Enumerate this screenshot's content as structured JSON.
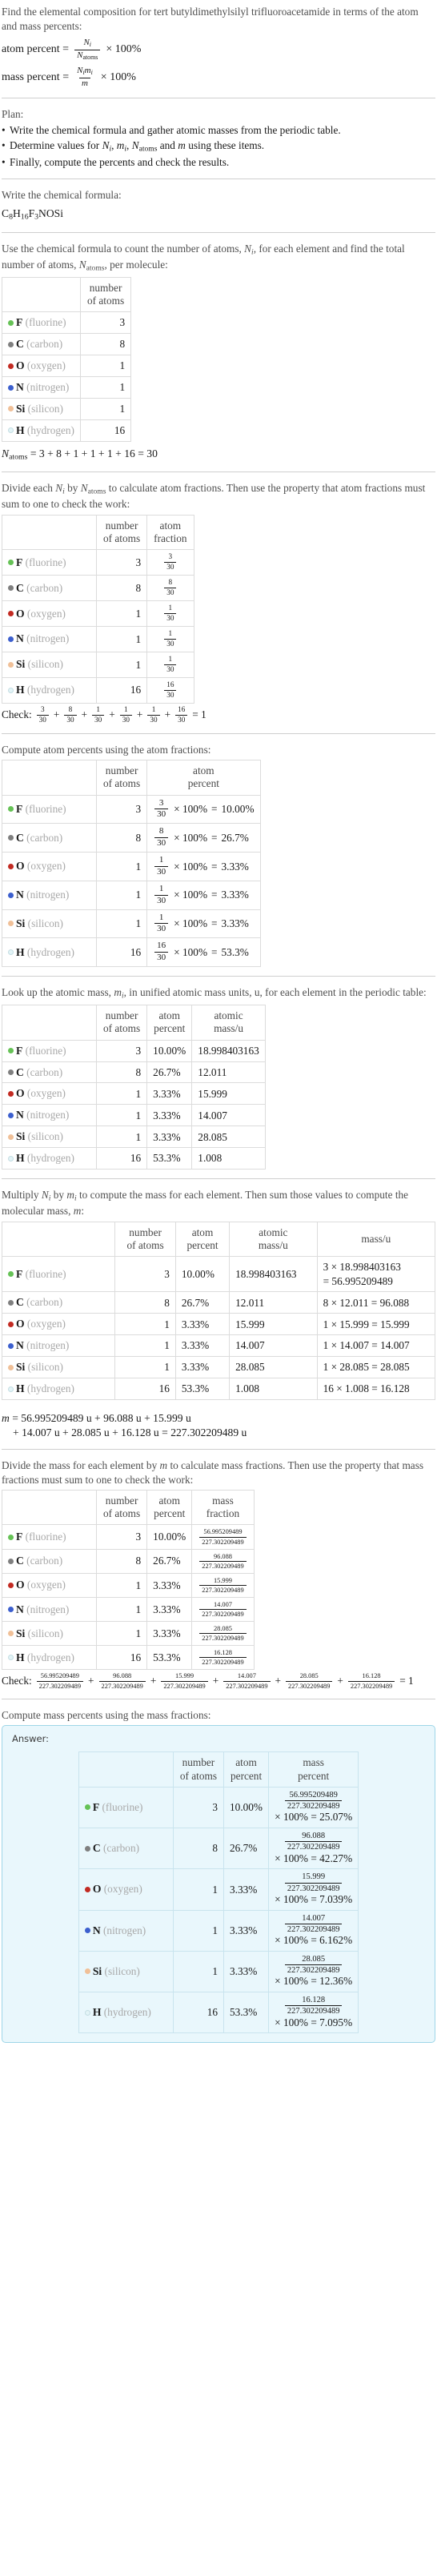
{
  "header": {
    "question": "Find the elemental composition for tert butyldimethylsilyl trifluoroacetamide in terms of the atom and mass percents:",
    "atom_percent_label": "atom percent =",
    "mass_percent_label": "mass percent =",
    "times_100": "× 100%",
    "Ni": "N",
    "Ni_sub": "i",
    "Natoms": "N",
    "Natoms_sub": "atoms",
    "mi": "m",
    "mi_sub": "i",
    "m": "m"
  },
  "plan": {
    "title": "Plan:",
    "items": [
      "Write the chemical formula and gather atomic masses from the periodic table.",
      "Determine values for Nᵢ, mᵢ, Nₐₜₒₘₛ and m using these items.",
      "Finally, compute the percents and check the results."
    ],
    "item2_parts": {
      "pre": "Determine values for ",
      "mid": " and ",
      "post": " using these items."
    }
  },
  "formula_section": {
    "prompt": "Write the chemical formula:",
    "formula_parts": [
      {
        "sym": "C",
        "sub": "8"
      },
      {
        "sym": "H",
        "sub": "16"
      },
      {
        "sym": "F",
        "sub": "3"
      },
      {
        "sym": "NOSi",
        "sub": ""
      }
    ],
    "formula_plain": "C8H16F3NOSi"
  },
  "count_section": {
    "prompt": "Use the chemical formula to count the number of atoms, Nᵢ, for each element and find the total number of atoms, Nₐₜₒₘₛ, per molecule:",
    "prompt_parts": {
      "p1": "Use the chemical formula to count the number of atoms, ",
      "p2": ", for each element and find the total number of atoms, ",
      "p3": ", per molecule:"
    },
    "header_number_of_atoms": [
      "number",
      "of atoms"
    ],
    "total_equation": "= 3 + 8 + 1 + 1 + 1 + 16 = 30"
  },
  "fraction_section": {
    "prompt_parts": {
      "p1": "Divide each ",
      "p2": " by ",
      "p3": " to calculate atom fractions. Then use the property that atom fractions must sum to one to check the work:"
    },
    "header_atom_fraction": [
      "atom",
      "fraction"
    ],
    "check_label": "Check:",
    "check_result": "= 1"
  },
  "atom_percent_section": {
    "prompt": "Compute atom percents using the atom fractions:",
    "header_atom_percent": [
      "atom",
      "percent"
    ]
  },
  "atomic_mass_section": {
    "prompt_parts": {
      "p1": "Look up the atomic mass, ",
      "p2": ", in unified atomic mass units, u, for each element in the periodic table:"
    },
    "header_atomic_mass": [
      "atomic",
      "mass/u"
    ]
  },
  "mass_section": {
    "prompt_parts": {
      "p1": "Multiply ",
      "p2": " by ",
      "p3": " to compute the mass for each element. Then sum those values to compute the molecular mass, ",
      "p4": ":"
    },
    "header_mass": [
      "",
      "mass/u"
    ],
    "molecular_mass_line1": "= 56.995209489 u + 96.088 u + 15.999 u",
    "molecular_mass_line2": "+ 14.007 u + 28.085 u + 16.128 u = 227.302209489 u"
  },
  "mass_fraction_section": {
    "prompt_parts": {
      "p1": "Divide the mass for each element by ",
      "p2": " to calculate mass fractions. Then use the property that mass fractions must sum to one to check the work:"
    },
    "header_mass_fraction": [
      "mass",
      "fraction"
    ],
    "check_label": "Check:",
    "check_result": "= 1"
  },
  "mass_percent_section": {
    "prompt": "Compute mass percents using the mass fractions:",
    "answer_label": "Answer:",
    "header_mass_percent": [
      "mass",
      "percent"
    ]
  },
  "totals": {
    "N_atoms": "30",
    "molecular_mass": "227.302209489"
  },
  "elements": [
    {
      "symbol": "F",
      "name": "(fluorine)",
      "color": "#66c256",
      "hollow": false,
      "count": "3",
      "atom_fraction_num": "3",
      "atom_fraction_den": "30",
      "atom_percent": "10.00%",
      "atomic_mass": "18.998403163",
      "mass_expr": "3 × 18.998403163",
      "mass_expr_eq": "= 56.995209489",
      "mass_expr_oneline": "3 × 18.998403163 = 56.995209489",
      "mass_value": "56.995209489",
      "mass_percent": "25.07%"
    },
    {
      "symbol": "C",
      "name": "(carbon)",
      "color": "#7f7f7f",
      "hollow": false,
      "count": "8",
      "atom_fraction_num": "8",
      "atom_fraction_den": "30",
      "atom_percent": "26.7%",
      "atomic_mass": "12.011",
      "mass_expr": "8 × 12.011 = 96.088",
      "mass_expr_eq": "",
      "mass_expr_oneline": "8 × 12.011 = 96.088",
      "mass_value": "96.088",
      "mass_percent": "42.27%"
    },
    {
      "symbol": "O",
      "name": "(oxygen)",
      "color": "#c22a22",
      "hollow": false,
      "count": "1",
      "atom_fraction_num": "1",
      "atom_fraction_den": "30",
      "atom_percent": "3.33%",
      "atomic_mass": "15.999",
      "mass_expr": "1 × 15.999 = 15.999",
      "mass_expr_eq": "",
      "mass_expr_oneline": "1 × 15.999 = 15.999",
      "mass_value": "15.999",
      "mass_percent": "7.039%"
    },
    {
      "symbol": "N",
      "name": "(nitrogen)",
      "color": "#3c5fce",
      "hollow": false,
      "count": "1",
      "atom_fraction_num": "1",
      "atom_fraction_den": "30",
      "atom_percent": "3.33%",
      "atomic_mass": "14.007",
      "mass_expr": "1 × 14.007 = 14.007",
      "mass_expr_eq": "",
      "mass_expr_oneline": "1 × 14.007 = 14.007",
      "mass_value": "14.007",
      "mass_percent": "6.162%"
    },
    {
      "symbol": "Si",
      "name": "(silicon)",
      "color": "#f0c098",
      "hollow": false,
      "count": "1",
      "atom_fraction_num": "1",
      "atom_fraction_den": "30",
      "atom_percent": "3.33%",
      "atomic_mass": "28.085",
      "mass_expr": "1 × 28.085 = 28.085",
      "mass_expr_eq": "",
      "mass_expr_oneline": "1 × 28.085 = 28.085",
      "mass_value": "28.085",
      "mass_percent": "12.36%"
    },
    {
      "symbol": "H",
      "name": "(hydrogen)",
      "color": "#e3f4f7",
      "hollow": true,
      "count": "16",
      "atom_fraction_num": "16",
      "atom_fraction_den": "30",
      "atom_percent": "53.3%",
      "atomic_mass": "1.008",
      "mass_expr": "16 × 1.008 = 16.128",
      "mass_expr_eq": "",
      "mass_expr_oneline": "16 × 1.008 = 16.128",
      "mass_value": "16.128",
      "mass_percent": "7.095%"
    }
  ],
  "symbols": {
    "times100": "× 100%",
    "equals": "=",
    "plus": "+",
    "times": "×"
  }
}
